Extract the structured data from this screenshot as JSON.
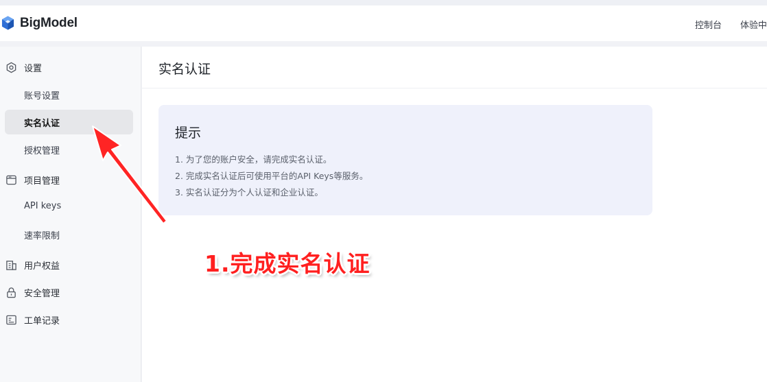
{
  "header": {
    "logo_text": "BigModel",
    "nav": {
      "console": "控制台",
      "experience": "体验中"
    }
  },
  "sidebar": {
    "settings": {
      "label": "设置",
      "icon": "gear-icon",
      "items": [
        {
          "label": "账号设置"
        },
        {
          "label": "实名认证",
          "active": true
        },
        {
          "label": "授权管理"
        }
      ]
    },
    "project": {
      "label": "项目管理",
      "icon": "window-icon",
      "items": [
        {
          "label": "API keys"
        },
        {
          "label": "速率限制"
        }
      ]
    },
    "user_rights": {
      "label": "用户权益",
      "icon": "building-icon"
    },
    "security": {
      "label": "安全管理",
      "icon": "lock-icon"
    },
    "tickets": {
      "label": "工单记录",
      "icon": "ticket-icon"
    }
  },
  "main": {
    "title": "实名认证",
    "tip": {
      "title": "提示",
      "lines": [
        "1. 为了您的账户安全，请完成实名认证。",
        "2. 完成实名认证后可使用平台的API Keys等服务。",
        "3. 实名认证分为个人认证和企业认证。"
      ]
    }
  },
  "annotation": {
    "text": "1.完成实名认证",
    "color": "#ff1f1f"
  },
  "colors": {
    "brand": "#3b7de0",
    "active_bg": "#e6e7ea",
    "tip_bg": "#eff1fb"
  }
}
